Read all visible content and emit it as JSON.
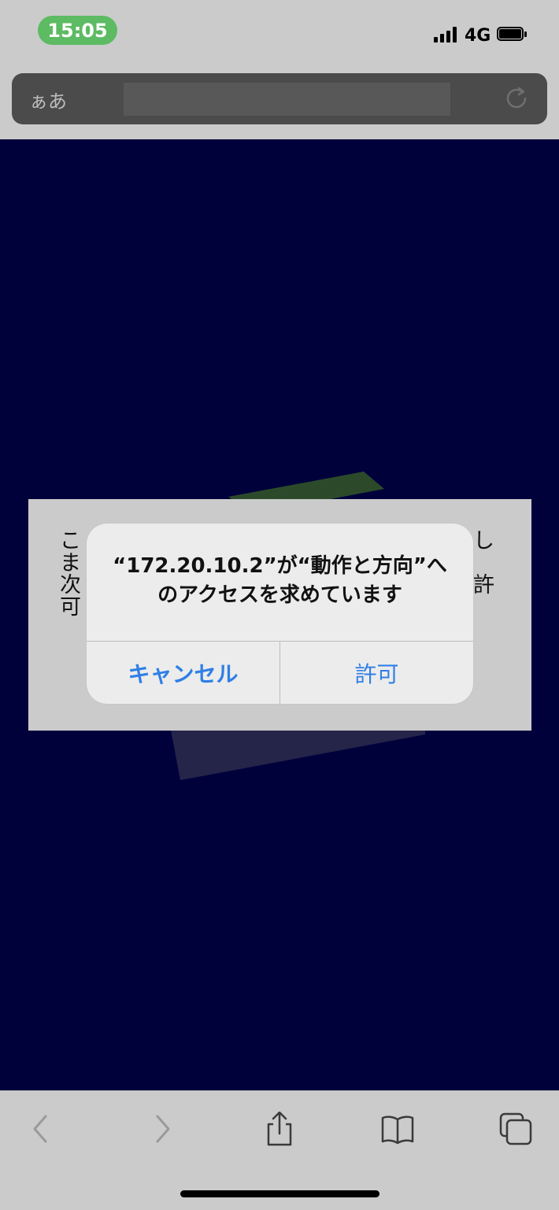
{
  "status_bar": {
    "time": "15:05",
    "network": "4G",
    "icons": [
      "signal-icon",
      "battery-icon"
    ]
  },
  "address_bar": {
    "aa_label": "ぁあ",
    "url_value": "",
    "icons": [
      "reload-icon"
    ]
  },
  "page_panel": {
    "lines": [
      "こ",
      "ま",
      "次",
      "可"
    ],
    "right_lines": [
      "し",
      "",
      "許"
    ]
  },
  "alert": {
    "title": "“172.20.10.2”が“動作と方向”へのアクセスを求めています",
    "cancel_label": "キャンセル",
    "allow_label": "許可",
    "accent_color": "#2f7fe6"
  },
  "bottom_toolbar": {
    "icons": [
      "back-icon",
      "forward-icon",
      "share-icon",
      "bookmarks-icon",
      "tabs-icon"
    ]
  },
  "colors": {
    "web_background": "#00003b",
    "chrome_gray": "#cbcbcb",
    "time_pill": "#5dbb63"
  }
}
